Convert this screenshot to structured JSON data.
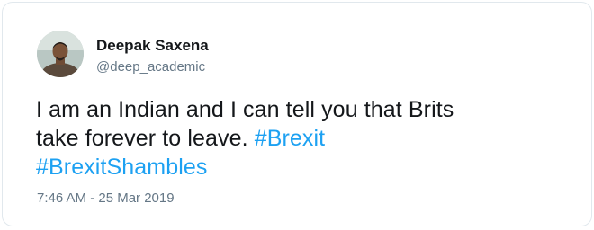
{
  "author": {
    "display_name": "Deepak Saxena",
    "handle": "@deep_academic",
    "avatar": "profile-photo"
  },
  "tweet": {
    "text_line1": "I am an Indian and I can tell you that Brits",
    "text_line2": "take forever to leave.",
    "hashtag1": "#Brexit",
    "hashtag2": "#BrexitShambles"
  },
  "meta": {
    "timestamp": "7:46 AM - 25 Mar 2019"
  },
  "colors": {
    "link": "#1da1f2",
    "text": "#14171a",
    "muted": "#657786"
  }
}
